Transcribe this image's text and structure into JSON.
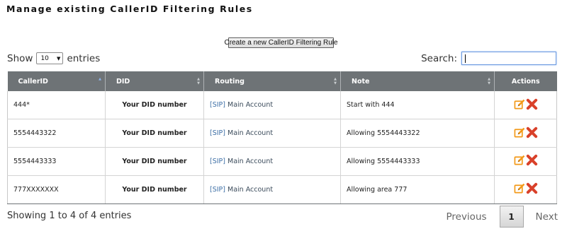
{
  "title": "Manage existing CallerID Filtering Rules",
  "create_button": "Create a new CallerID Filtering Rule",
  "length": {
    "show": "Show",
    "value": "10",
    "entries": "entries"
  },
  "search": {
    "label": "Search:",
    "value": ""
  },
  "columns": [
    "CallerID",
    "DID",
    "Routing",
    "Note",
    "Actions"
  ],
  "rows": [
    {
      "callerid": "444*",
      "did": "Your DID number",
      "routing_tag": "[SIP]",
      "routing_name": "Main Account",
      "note": "Start with 444"
    },
    {
      "callerid": "5554443322",
      "did": "Your DID number",
      "routing_tag": "[SIP]",
      "routing_name": "Main Account",
      "note": "Allowing 5554443322"
    },
    {
      "callerid": "5554443333",
      "did": "Your DID number",
      "routing_tag": "[SIP]",
      "routing_name": "Main Account",
      "note": "Allowing 5554443333"
    },
    {
      "callerid": "777XXXXXXX",
      "did": "Your DID number",
      "routing_tag": "[SIP]",
      "routing_name": "Main Account",
      "note": "Allowing area 777"
    }
  ],
  "info": "Showing 1 to 4 of 4 entries",
  "pagination": {
    "previous": "Previous",
    "current": "1",
    "next": "Next"
  },
  "icons": {
    "edit": "edit-icon",
    "delete": "delete-icon"
  },
  "colors": {
    "header_bg": "#6e7376",
    "link": "#3d6fa6",
    "edit": "#f39a1a",
    "delete": "#d9412a"
  }
}
